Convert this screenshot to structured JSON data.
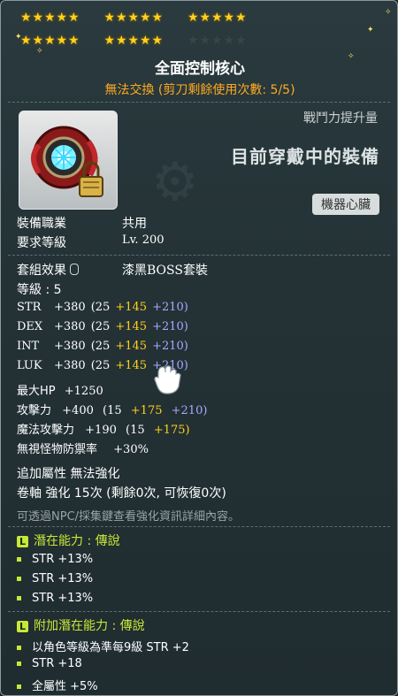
{
  "stars": {
    "row1_filled": 15,
    "row2_filled": 10,
    "row2_empty": 5
  },
  "item": {
    "title": "全面控制核心",
    "trade_note": "無法交換 (剪刀剩餘使用次數: 5/5)",
    "combat_power_label": "戰鬥力提升量",
    "equipped_label": "目前穿戴中的裝備",
    "category_tag": "機器心臟"
  },
  "requirements": {
    "job_label": "裝備職業",
    "job_value": "共用",
    "level_label": "要求等級",
    "level_value": "Lv. 200"
  },
  "set": {
    "label": "套組效果",
    "value": "漆黑BOSS套裝"
  },
  "level_line": "等級 : 5",
  "stats": [
    {
      "name": "STR",
      "total": "+380",
      "base": "(25",
      "bonus": "+145",
      "star": "+210)"
    },
    {
      "name": "DEX",
      "total": "+380",
      "base": "(25",
      "bonus": "+145",
      "star": "+210)"
    },
    {
      "name": "INT",
      "total": "+380",
      "base": "(25",
      "bonus": "+145",
      "star": "+210)"
    },
    {
      "name": "LUK",
      "total": "+380",
      "base": "(25",
      "bonus": "+145",
      "star": "+210)"
    }
  ],
  "hp": {
    "name": "最大HP",
    "value": "+1250"
  },
  "attack": {
    "name": "攻擊力",
    "total": "+400",
    "base": "(15",
    "bonus": "+175",
    "star": "+210)"
  },
  "magic": {
    "name": "魔法攻擊力",
    "total": "+190",
    "base": "(15",
    "bonus": "+175)"
  },
  "ied": {
    "name": "無視怪物防禦率",
    "value": "+30%"
  },
  "extra": {
    "bonus_line": "追加屬性 無法強化",
    "scroll_line": "卷軸 強化 15次 (剩餘0次, 可恢復0次)",
    "note": "可透過NPC/採集鍵查看強化資訊詳細內容。"
  },
  "potential": {
    "badge": "L",
    "header": "潛在能力 : 傳說",
    "lines": [
      "STR +13%",
      "STR +13%",
      "STR +13%"
    ]
  },
  "bonus_potential": {
    "badge": "L",
    "header": "附加潛在能力 : 傳說",
    "lines": [
      "以角色等級為準每9級 STR +2",
      "STR +18",
      "全屬性 +5%"
    ]
  }
}
